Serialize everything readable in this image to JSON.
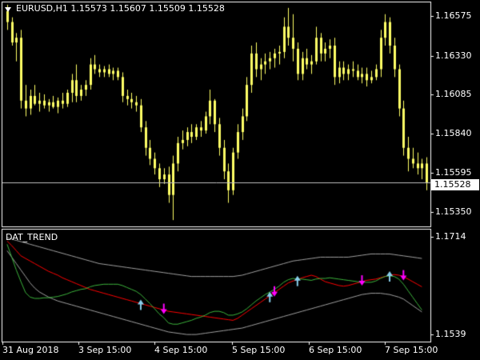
{
  "main": {
    "symbol_info": "EURUSD,H1  1.15573 1.15607 1.15509 1.15528",
    "current_price": "1.15528",
    "price_levels": [
      "1.16575",
      "1.16330",
      "1.16085",
      "1.15840",
      "1.15595",
      "1.15350"
    ],
    "price_range": [
      1.1525,
      1.1668
    ]
  },
  "indicator": {
    "name": "DAT_TREND",
    "levels": [
      "1.1714",
      "1.1539"
    ]
  },
  "time_axis": [
    "31 Aug 2018",
    "3 Sep 15:00",
    "4 Sep 15:00",
    "5 Sep 15:00",
    "6 Sep 15:00",
    "7 Sep 15:00"
  ],
  "colors": {
    "background": "#000000",
    "candle": "#ffff66",
    "grid": "#ffffff",
    "band": "#a0a0a0",
    "slow_line": "#ff0000",
    "fast_line": "#3cb43c",
    "up_arrow": "#87ceeb",
    "down_arrow": "#ff00ff"
  },
  "chart_data": {
    "type": "line",
    "title": "EURUSD,H1",
    "candles": [
      [
        1.1662,
        1.1666,
        1.165,
        1.1655
      ],
      [
        1.1655,
        1.1658,
        1.164,
        1.1642
      ],
      [
        1.1642,
        1.1648,
        1.163,
        1.1645
      ],
      [
        1.1645,
        1.165,
        1.16,
        1.1605
      ],
      [
        1.1605,
        1.1615,
        1.1595,
        1.16
      ],
      [
        1.16,
        1.1612,
        1.1596,
        1.1608
      ],
      [
        1.1608,
        1.1615,
        1.1602,
        1.1603
      ],
      [
        1.1603,
        1.161,
        1.1598,
        1.1605
      ],
      [
        1.1605,
        1.1609,
        1.16,
        1.1602
      ],
      [
        1.1602,
        1.1606,
        1.1598,
        1.1604
      ],
      [
        1.1604,
        1.1608,
        1.16,
        1.1601
      ],
      [
        1.1601,
        1.1607,
        1.1597,
        1.1605
      ],
      [
        1.1605,
        1.161,
        1.16,
        1.1603
      ],
      [
        1.1603,
        1.1612,
        1.1601,
        1.161
      ],
      [
        1.161,
        1.1622,
        1.1604,
        1.1618
      ],
      [
        1.1618,
        1.1628,
        1.1604,
        1.1608
      ],
      [
        1.1608,
        1.1615,
        1.1605,
        1.1612
      ],
      [
        1.1612,
        1.1618,
        1.1608,
        1.1615
      ],
      [
        1.1615,
        1.1632,
        1.1612,
        1.1628
      ],
      [
        1.1628,
        1.1634,
        1.1622,
        1.1625
      ],
      [
        1.1625,
        1.1628,
        1.162,
        1.1623
      ],
      [
        1.1623,
        1.1627,
        1.162,
        1.1625
      ],
      [
        1.1625,
        1.1628,
        1.162,
        1.1622
      ],
      [
        1.1622,
        1.1626,
        1.1618,
        1.1624
      ],
      [
        1.1624,
        1.1626,
        1.1618,
        1.162
      ],
      [
        1.162,
        1.1623,
        1.1604,
        1.1608
      ],
      [
        1.1608,
        1.1612,
        1.1602,
        1.1606
      ],
      [
        1.1606,
        1.161,
        1.16,
        1.1604
      ],
      [
        1.1604,
        1.1608,
        1.1598,
        1.1602
      ],
      [
        1.1602,
        1.1606,
        1.1585,
        1.1588
      ],
      [
        1.1588,
        1.1592,
        1.157,
        1.1575
      ],
      [
        1.1575,
        1.158,
        1.1564,
        1.1568
      ],
      [
        1.1568,
        1.1572,
        1.1558,
        1.1562
      ],
      [
        1.1562,
        1.1565,
        1.155,
        1.1555
      ],
      [
        1.1555,
        1.1562,
        1.1552,
        1.1558
      ],
      [
        1.1558,
        1.1563,
        1.154,
        1.1545
      ],
      [
        1.1545,
        1.157,
        1.1529,
        1.1565
      ],
      [
        1.1565,
        1.1582,
        1.156,
        1.1578
      ],
      [
        1.1578,
        1.1586,
        1.1574,
        1.158
      ],
      [
        1.158,
        1.1588,
        1.1576,
        1.1585
      ],
      [
        1.1585,
        1.159,
        1.1578,
        1.1582
      ],
      [
        1.1582,
        1.159,
        1.158,
        1.1588
      ],
      [
        1.1588,
        1.1592,
        1.1582,
        1.1586
      ],
      [
        1.1586,
        1.1598,
        1.1584,
        1.1595
      ],
      [
        1.1595,
        1.1612,
        1.159,
        1.1605
      ],
      [
        1.1605,
        1.1606,
        1.1585,
        1.159
      ],
      [
        1.159,
        1.1594,
        1.157,
        1.1575
      ],
      [
        1.1575,
        1.158,
        1.1555,
        1.156
      ],
      [
        1.156,
        1.1565,
        1.154,
        1.1548
      ],
      [
        1.1548,
        1.1575,
        1.1545,
        1.1572
      ],
      [
        1.1572,
        1.159,
        1.1568,
        1.1585
      ],
      [
        1.1585,
        1.16,
        1.158,
        1.1595
      ],
      [
        1.1595,
        1.162,
        1.1592,
        1.1615
      ],
      [
        1.1615,
        1.164,
        1.161,
        1.1635
      ],
      [
        1.1635,
        1.1642,
        1.162,
        1.1625
      ],
      [
        1.1625,
        1.1632,
        1.1618,
        1.1628
      ],
      [
        1.1628,
        1.1635,
        1.1622,
        1.163
      ],
      [
        1.163,
        1.1636,
        1.1625,
        1.1632
      ],
      [
        1.1632,
        1.1638,
        1.1626,
        1.1635
      ],
      [
        1.1635,
        1.164,
        1.1628,
        1.1636
      ],
      [
        1.1636,
        1.1658,
        1.1632,
        1.1652
      ],
      [
        1.1652,
        1.1664,
        1.164,
        1.1645
      ],
      [
        1.1645,
        1.166,
        1.163,
        1.1638
      ],
      [
        1.1638,
        1.1642,
        1.1618,
        1.1622
      ],
      [
        1.1622,
        1.1636,
        1.1618,
        1.1632
      ],
      [
        1.1632,
        1.1638,
        1.1625,
        1.1628
      ],
      [
        1.1628,
        1.1634,
        1.1622,
        1.163
      ],
      [
        1.163,
        1.1652,
        1.1628,
        1.1645
      ],
      [
        1.1645,
        1.1648,
        1.163,
        1.1635
      ],
      [
        1.1635,
        1.1642,
        1.163,
        1.1638
      ],
      [
        1.1638,
        1.1644,
        1.1632,
        1.164
      ],
      [
        1.164,
        1.1645,
        1.1615,
        1.162
      ],
      [
        1.162,
        1.163,
        1.1616,
        1.1626
      ],
      [
        1.1626,
        1.163,
        1.1618,
        1.1622
      ],
      [
        1.1622,
        1.1628,
        1.1618,
        1.1625
      ],
      [
        1.1625,
        1.163,
        1.162,
        1.1624
      ],
      [
        1.1624,
        1.1628,
        1.1618,
        1.162
      ],
      [
        1.162,
        1.1626,
        1.1616,
        1.1622
      ],
      [
        1.1622,
        1.1626,
        1.1614,
        1.1618
      ],
      [
        1.1618,
        1.1624,
        1.1616,
        1.162
      ],
      [
        1.162,
        1.1628,
        1.1618,
        1.1625
      ],
      [
        1.1625,
        1.165,
        1.162,
        1.1645
      ],
      [
        1.1645,
        1.166,
        1.164,
        1.1655
      ],
      [
        1.1655,
        1.1658,
        1.1635,
        1.164
      ],
      [
        1.164,
        1.1645,
        1.162,
        1.1625
      ],
      [
        1.1625,
        1.1628,
        1.1595,
        1.16
      ],
      [
        1.16,
        1.1605,
        1.157,
        1.1575
      ],
      [
        1.1575,
        1.1582,
        1.156,
        1.1568
      ],
      [
        1.1568,
        1.1575,
        1.1562,
        1.1565
      ],
      [
        1.1565,
        1.1572,
        1.1558,
        1.1562
      ],
      [
        1.1562,
        1.1568,
        1.1555,
        1.1565
      ],
      [
        1.1565,
        1.1569,
        1.1548,
        1.1553
      ]
    ],
    "dat_trend": {
      "slow": [
        1.1695,
        1.1688,
        1.168,
        1.1672,
        1.1668,
        1.1664,
        1.166,
        1.1656,
        1.1652,
        1.1648,
        1.1645,
        1.1642,
        1.1638,
        1.1635,
        1.1632,
        1.1629,
        1.1626,
        1.1623,
        1.162,
        1.1618,
        1.1616,
        1.1614,
        1.1612,
        1.161,
        1.1608,
        1.1606,
        1.1604,
        1.1602,
        1.16,
        1.1598,
        1.1596,
        1.1594,
        1.1592,
        1.159,
        1.1588,
        1.1586,
        1.1585,
        1.1584,
        1.1583,
        1.1582,
        1.1581,
        1.158,
        1.1579,
        1.1578,
        1.1577,
        1.1576,
        1.1575,
        1.1574,
        1.1573,
        1.1572,
        1.1575,
        1.158,
        1.1585,
        1.159,
        1.1595,
        1.16,
        1.1605,
        1.161,
        1.1615,
        1.162,
        1.1625,
        1.163,
        1.1633,
        1.1635,
        1.1638,
        1.164,
        1.1642,
        1.164,
        1.1636,
        1.1632,
        1.163,
        1.1628,
        1.1626,
        1.1625,
        1.1626,
        1.1628,
        1.163,
        1.1632,
        1.1634,
        1.1635,
        1.1636,
        1.1638,
        1.164,
        1.1642,
        1.1643,
        1.1642,
        1.164,
        1.1636,
        1.1632,
        1.1628,
        1.1624
      ],
      "fast": [
        1.169,
        1.167,
        1.165,
        1.1632,
        1.1615,
        1.1608,
        1.1606,
        1.1606,
        1.1607,
        1.1607,
        1.1608,
        1.1609,
        1.1611,
        1.1613,
        1.1616,
        1.1618,
        1.162,
        1.1621,
        1.1624,
        1.1626,
        1.1627,
        1.1628,
        1.1628,
        1.1628,
        1.1628,
        1.1626,
        1.1623,
        1.162,
        1.1617,
        1.1612,
        1.1605,
        1.1598,
        1.159,
        1.1582,
        1.1576,
        1.1568,
        1.1566,
        1.1566,
        1.1568,
        1.157,
        1.1572,
        1.1575,
        1.1577,
        1.158,
        1.1584,
        1.1586,
        1.1586,
        1.1584,
        1.158,
        1.158,
        1.1582,
        1.1585,
        1.159,
        1.1596,
        1.1602,
        1.1607,
        1.1612,
        1.1616,
        1.162,
        1.1625,
        1.1631,
        1.1635,
        1.1637,
        1.1636,
        1.1636,
        1.1635,
        1.1634,
        1.1636,
        1.1637,
        1.1637,
        1.1638,
        1.1637,
        1.1636,
        1.1635,
        1.1634,
        1.1633,
        1.1632,
        1.1631,
        1.1631,
        1.1631,
        1.1633,
        1.1637,
        1.164,
        1.1641,
        1.164,
        1.1636,
        1.1628,
        1.1618,
        1.1608,
        1.1598,
        1.1588
      ],
      "upper": [
        1.17,
        1.1698,
        1.1696,
        1.1694,
        1.1692,
        1.169,
        1.1688,
        1.1686,
        1.1684,
        1.1682,
        1.168,
        1.1678,
        1.1676,
        1.1674,
        1.1672,
        1.167,
        1.1668,
        1.1666,
        1.1664,
        1.1662,
        1.166,
        1.1659,
        1.1658,
        1.1657,
        1.1656,
        1.1655,
        1.1654,
        1.1653,
        1.1652,
        1.1651,
        1.165,
        1.1649,
        1.1648,
        1.1647,
        1.1646,
        1.1645,
        1.1644,
        1.1643,
        1.1642,
        1.1641,
        1.164,
        1.164,
        1.164,
        1.164,
        1.164,
        1.164,
        1.164,
        1.164,
        1.164,
        1.164,
        1.1641,
        1.1642,
        1.1644,
        1.1646,
        1.1648,
        1.165,
        1.1652,
        1.1654,
        1.1656,
        1.1658,
        1.166,
        1.1662,
        1.1664,
        1.1665,
        1.1666,
        1.1667,
        1.1668,
        1.1669,
        1.167,
        1.167,
        1.167,
        1.167,
        1.167,
        1.167,
        1.167,
        1.1671,
        1.1672,
        1.1673,
        1.1674,
        1.1675,
        1.1675,
        1.1675,
        1.1675,
        1.1675,
        1.1674,
        1.1673,
        1.1672,
        1.1671,
        1.167,
        1.1669,
        1.1668
      ],
      "lower": [
        1.168,
        1.167,
        1.166,
        1.165,
        1.164,
        1.163,
        1.1622,
        1.1616,
        1.1612,
        1.1608,
        1.1605,
        1.1602,
        1.16,
        1.1598,
        1.1596,
        1.1594,
        1.1592,
        1.159,
        1.1588,
        1.1586,
        1.1584,
        1.1582,
        1.158,
        1.1578,
        1.1576,
        1.1574,
        1.1572,
        1.157,
        1.1568,
        1.1566,
        1.1564,
        1.1562,
        1.156,
        1.1558,
        1.1556,
        1.1554,
        1.1553,
        1.1552,
        1.1551,
        1.155,
        1.155,
        1.155,
        1.1551,
        1.1552,
        1.1553,
        1.1554,
        1.1555,
        1.1556,
        1.1557,
        1.1558,
        1.1559,
        1.156,
        1.1562,
        1.1564,
        1.1566,
        1.1568,
        1.157,
        1.1572,
        1.1574,
        1.1576,
        1.1578,
        1.158,
        1.1582,
        1.1584,
        1.1586,
        1.1588,
        1.159,
        1.1592,
        1.1594,
        1.1596,
        1.1598,
        1.16,
        1.1602,
        1.1604,
        1.1606,
        1.1608,
        1.161,
        1.1612,
        1.1613,
        1.1614,
        1.1614,
        1.1614,
        1.1613,
        1.1612,
        1.161,
        1.1608,
        1.1605,
        1.16,
        1.1595,
        1.159,
        1.1585
      ],
      "up_arrows": [
        29,
        57,
        63,
        83
      ],
      "down_arrows": [
        34,
        58,
        77,
        86
      ],
      "range": [
        1.1539,
        1.1714
      ]
    }
  }
}
